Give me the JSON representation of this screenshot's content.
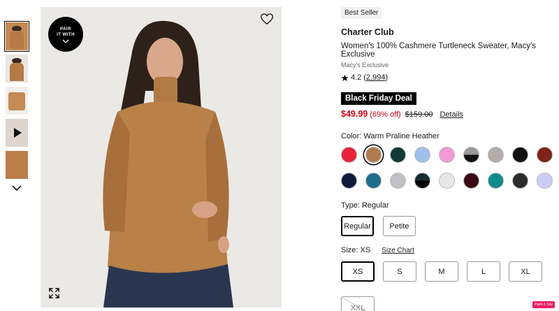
{
  "gallery": {
    "pair_line1": "PAIR",
    "pair_line2": "IT WITH"
  },
  "product": {
    "badge": "Best Seller",
    "brand": "Charter Club",
    "name": "Women's 100% Cashmere Turtleneck Sweater, Macy's Exclusive",
    "exclusive": "Macy's Exclusive",
    "rating": "4.2",
    "review_count": "2,994",
    "deal": "Black Friday Deal",
    "sale_price": "$49.99",
    "discount": "(69% off)",
    "original_price": "$159.00",
    "details_link": "Details"
  },
  "color": {
    "label": "Color: Warm Praline Heather",
    "swatches": [
      "#e8233a",
      "#b07a4c",
      "#0f3b36",
      "#9ec0ea",
      "#f29ad7",
      "#8d8d8d",
      "#b4abab",
      "#111111",
      "#7f2418",
      "#0f1a3a",
      "#1d6c8a",
      "#bfbfc4",
      "#1a2a33",
      "#e7e7e7",
      "#3a0a14",
      "#0f8b8b",
      "#2b2b2b",
      "#c9cdf6"
    ]
  },
  "type": {
    "label": "Type: Regular",
    "options": [
      "Regular",
      "Petite"
    ]
  },
  "size": {
    "label": "Size: XS",
    "chart_link": "Size Chart",
    "options": [
      "XS",
      "S",
      "M",
      "L",
      "XL"
    ],
    "unavailable": "XXL"
  },
  "floating_tag": "Paint X Site"
}
